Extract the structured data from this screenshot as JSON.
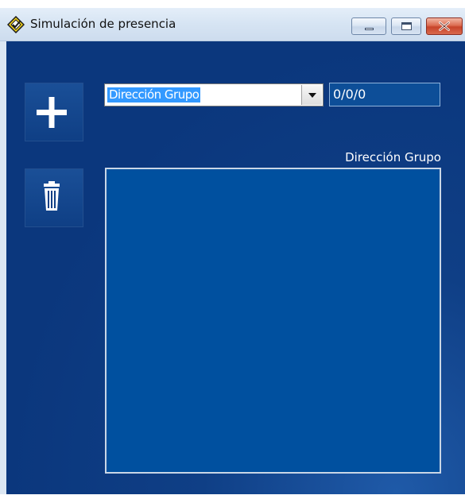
{
  "window": {
    "title": "Simulación de presencia",
    "icon": "app-icon"
  },
  "toolbar": {
    "add_icon": "plus-icon",
    "delete_icon": "trash-icon"
  },
  "group_select": {
    "value": "Dirección Grupo"
  },
  "address_field": {
    "value": "0/0/0"
  },
  "list": {
    "header": "Dirección Grupo",
    "items": []
  },
  "colors": {
    "background": "#0c3a80",
    "list_background": "#00509f",
    "selection": "#3399ff",
    "close_button": "#c7442a"
  }
}
